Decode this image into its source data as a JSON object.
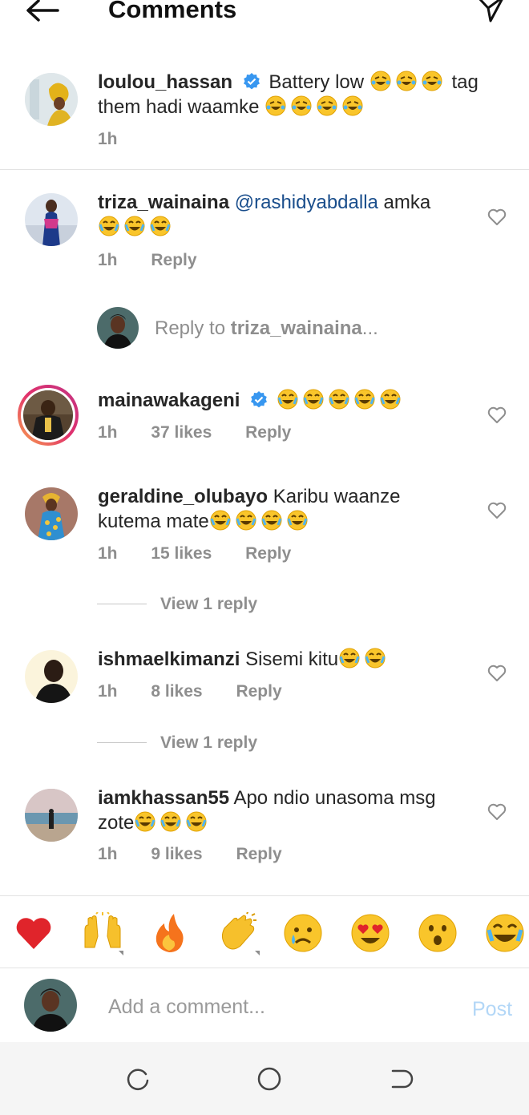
{
  "header": {
    "title": "Comments",
    "back_icon": "arrow-left-icon",
    "send_icon": "send-icon"
  },
  "comments": [
    {
      "username": "loulou_hassan",
      "verified": true,
      "text": "Battery low",
      "text2": "tag",
      "text3": "them hadi waamke",
      "time": "1h"
    },
    {
      "username": "triza_wainaina",
      "mention": "@rashidyabdalla",
      "text": "amka",
      "time": "1h",
      "reply": "Reply"
    },
    {
      "username": "mainawakageni",
      "verified": true,
      "time": "1h",
      "likes": "37 likes",
      "reply": "Reply"
    },
    {
      "username": "geraldine_olubayo",
      "text": "Karibu waanze",
      "text2": "kutema mate",
      "time": "1h",
      "likes": "15 likes",
      "reply": "Reply",
      "view_replies": "View 1 reply"
    },
    {
      "username": "ishmaelkimanzi",
      "text": "Sisemi kitu",
      "time": "1h",
      "likes": "8 likes",
      "reply": "Reply",
      "view_replies": "View 1 reply"
    },
    {
      "username": "iamkhassan55",
      "text": "Apo ndio unasoma msg",
      "text2": "zote",
      "time": "1h",
      "likes": "9 likes",
      "reply": "Reply"
    }
  ],
  "reply_prompt": {
    "prefix": "Reply to",
    "username": "triza_wainaina",
    "suffix": "..."
  },
  "reactions": [
    "❤️",
    "🙌",
    "🔥",
    "👏",
    "😢",
    "😍",
    "😮",
    "😂"
  ],
  "composer": {
    "placeholder": "Add a comment...",
    "post_label": "Post"
  },
  "colors": {
    "accent": "#0095f6",
    "verified": "#3897f0",
    "muted": "#8e8e8e",
    "mention": "#1a4e8c"
  }
}
